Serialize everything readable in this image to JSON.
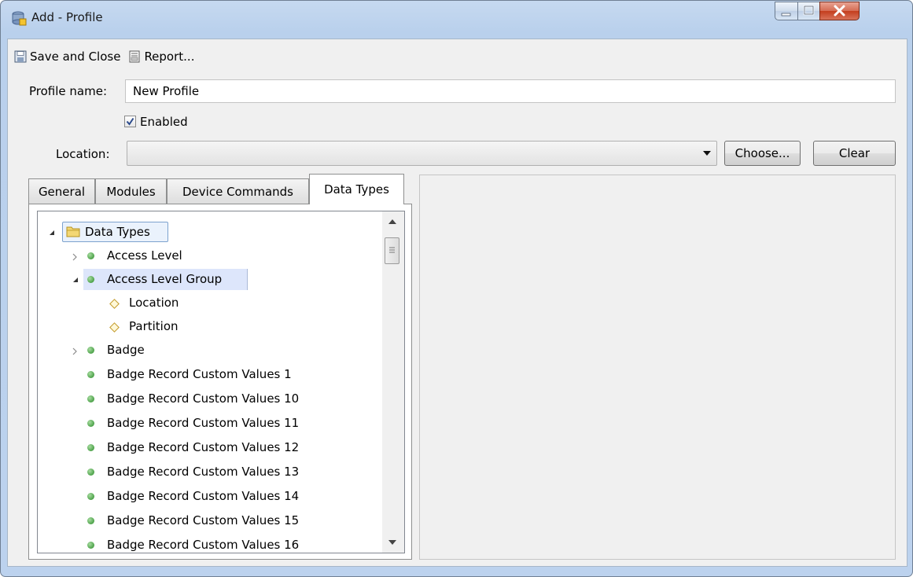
{
  "window": {
    "title": "Add - Profile"
  },
  "toolbar": {
    "save_label": "Save and Close",
    "report_label": "Report..."
  },
  "form": {
    "profile_name_label": "Profile name:",
    "profile_name_value": "New Profile",
    "enabled_label": "Enabled",
    "enabled_checked": true,
    "location_label": "Location:",
    "location_value": "",
    "choose_label": "Choose...",
    "clear_label": "Clear"
  },
  "tabs": [
    {
      "label": "General",
      "active": false
    },
    {
      "label": "Modules",
      "active": false
    },
    {
      "label": "Device Commands",
      "active": false
    },
    {
      "label": "Data Types",
      "active": true
    }
  ],
  "tree": {
    "root": {
      "label": "Data Types",
      "icon": "folder-icon",
      "expanded": true
    },
    "items": [
      {
        "label": "Access Level",
        "icon": "green-dot",
        "expander": "collapsed"
      },
      {
        "label": "Access Level Group",
        "icon": "green-dot",
        "expander": "expanded",
        "selected": true
      },
      {
        "label": "Location",
        "icon": "diamond"
      },
      {
        "label": "Partition",
        "icon": "diamond"
      },
      {
        "label": "Badge",
        "icon": "green-dot",
        "expander": "collapsed"
      },
      {
        "label": "Badge Record Custom Values 1",
        "icon": "green-dot"
      },
      {
        "label": "Badge Record Custom Values 10",
        "icon": "green-dot"
      },
      {
        "label": "Badge Record Custom Values 11",
        "icon": "green-dot"
      },
      {
        "label": "Badge Record Custom Values 12",
        "icon": "green-dot"
      },
      {
        "label": "Badge Record Custom Values 13",
        "icon": "green-dot"
      },
      {
        "label": "Badge Record Custom Values 14",
        "icon": "green-dot"
      },
      {
        "label": "Badge Record Custom Values 15",
        "icon": "green-dot"
      },
      {
        "label": "Badge Record Custom Values 16",
        "icon": "green-dot"
      }
    ]
  },
  "colors": {
    "title_bar": "#b9d0ec",
    "client_bg": "#f0f0f0",
    "selection": "#dde6fb",
    "close_button": "#c43e1e"
  }
}
